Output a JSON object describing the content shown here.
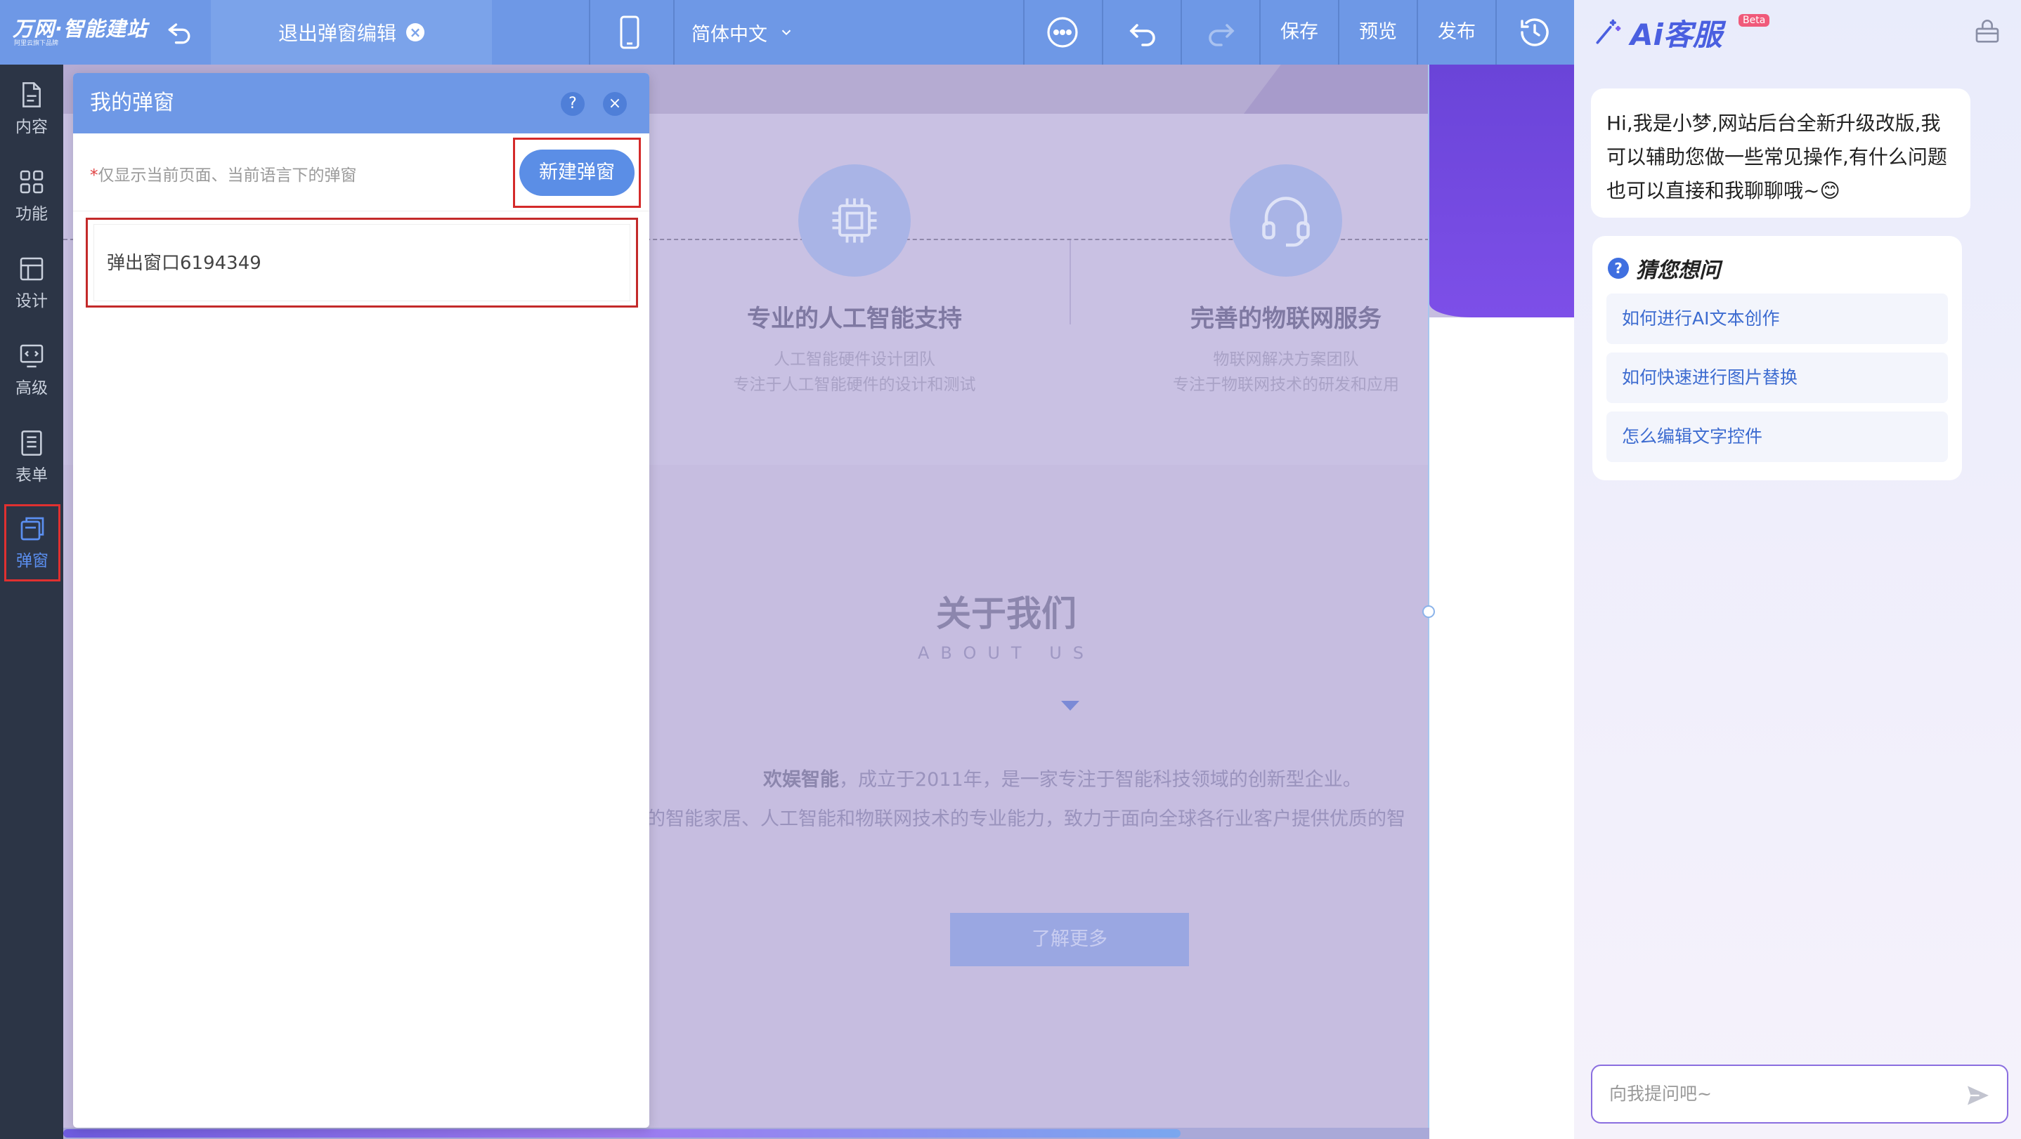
{
  "topbar": {
    "logo": "万网·智能建站",
    "logo_sub": "阿里云旗下品牌",
    "exit_label": "退出弹窗编辑",
    "exit_close": "×",
    "language": "简体中文",
    "save": "保存",
    "preview": "预览",
    "publish": "发布"
  },
  "sidebar": {
    "items": [
      {
        "label": "内容",
        "icon": "document-icon"
      },
      {
        "label": "功能",
        "icon": "grid-icon"
      },
      {
        "label": "设计",
        "icon": "layout-icon"
      },
      {
        "label": "高级",
        "icon": "code-monitor-icon"
      },
      {
        "label": "表单",
        "icon": "form-list-icon"
      },
      {
        "label": "弹窗",
        "icon": "popup-icon"
      }
    ],
    "active_index": 5
  },
  "canvas": {
    "card1_title": "专业的人工智能支持",
    "card1_desc1": "人工智能硬件设计团队",
    "card1_desc2": "专注于人工智能硬件的设计和测试",
    "card2_title": "完善的物联网服务",
    "card2_desc1": "物联网解决方案团队",
    "card2_desc2": "专注于物联网技术的研发和应用",
    "about_title": "关于我们",
    "about_sub": "ABOUT US",
    "about_bold": "欢娱智能",
    "about_p1_rest": "，成立于2011年，是一家专注于智能科技领域的创新型企业。",
    "about_p2": "的智能家居、人工智能和物联网技术的专业能力，致力于面向全球各行业客户提供优质的智",
    "learn_more": "了解更多"
  },
  "popup_panel": {
    "title": "我的弹窗",
    "help": "?",
    "close": "×",
    "note_star": "*",
    "note": "仅显示当前页面、当前语言下的弹窗",
    "new_button": "新建弹窗",
    "items": [
      "弹出窗口6194349"
    ]
  },
  "ai_panel": {
    "title": "Ai客服",
    "badge": "Beta",
    "greeting": "Hi,我是小梦,网站后台全新升级改版,我可以辅助您做一些常见操作,有什么问题也可以直接和我聊聊哦~😊",
    "suggest_icon": "?",
    "suggest_title": "猜您想问",
    "suggestions": [
      "如何进行AI文本创作",
      "如何快速进行图片替换",
      "怎么编辑文字控件"
    ],
    "input_placeholder": "向我提问吧~"
  },
  "colors": {
    "topbar": "#6e98e6",
    "sidebar": "#2c3546",
    "accent": "#5b8ee6",
    "highlight_border": "#d42a2a"
  }
}
